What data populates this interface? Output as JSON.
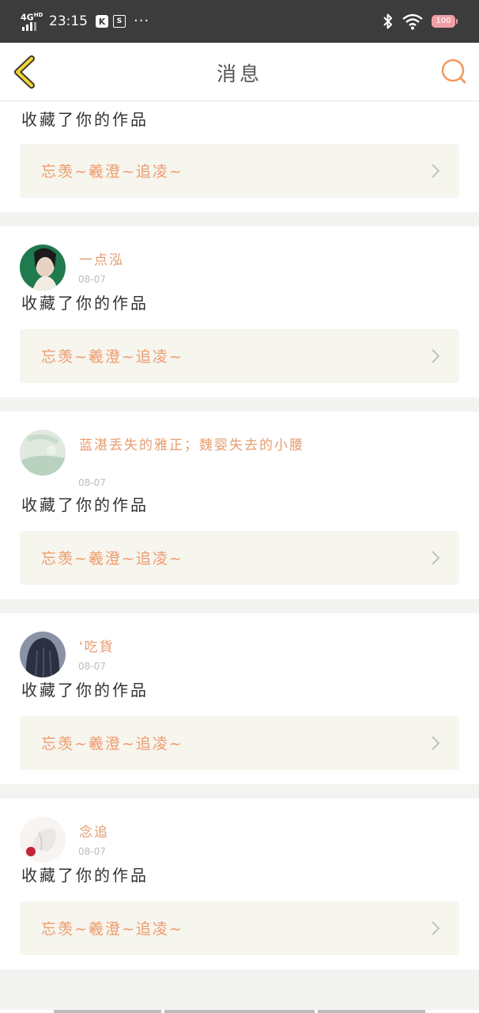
{
  "status_bar": {
    "network": "4G",
    "network_sup": "HD",
    "time": "23:15",
    "k_badge": "K",
    "s_badge": "S",
    "more": "···",
    "battery_level": "100"
  },
  "nav": {
    "title": "消息",
    "back_icon": "chevron-left-icon",
    "search_icon": "search-icon"
  },
  "notifications": [
    {
      "user": "",
      "date": "",
      "action": "收藏了你的作品",
      "work_title": "忘羡~羲澄~追凌~"
    },
    {
      "user": "一点泓",
      "date": "08-07",
      "action": "收藏了你的作品",
      "work_title": "忘羡~羲澄~追凌~"
    },
    {
      "user": "蓝湛丢失的雅正；魏婴失去的小腰",
      "date": "08-07",
      "action": "收藏了你的作品",
      "work_title": "忘羡~羲澄~追凌~"
    },
    {
      "user": "'吃貨",
      "date": "08-07",
      "action": "收藏了你的作品",
      "work_title": "忘羡~羲澄~追凌~"
    },
    {
      "user": "念追",
      "date": "08-07",
      "action": "收藏了你的作品",
      "work_title": "忘羡~羲澄~追凌~"
    }
  ],
  "colors": {
    "accent": "#e69d72",
    "work_title": "#ef9b6c",
    "status_bar": "#3c3c3c",
    "box_bg": "#f6f5ee"
  }
}
